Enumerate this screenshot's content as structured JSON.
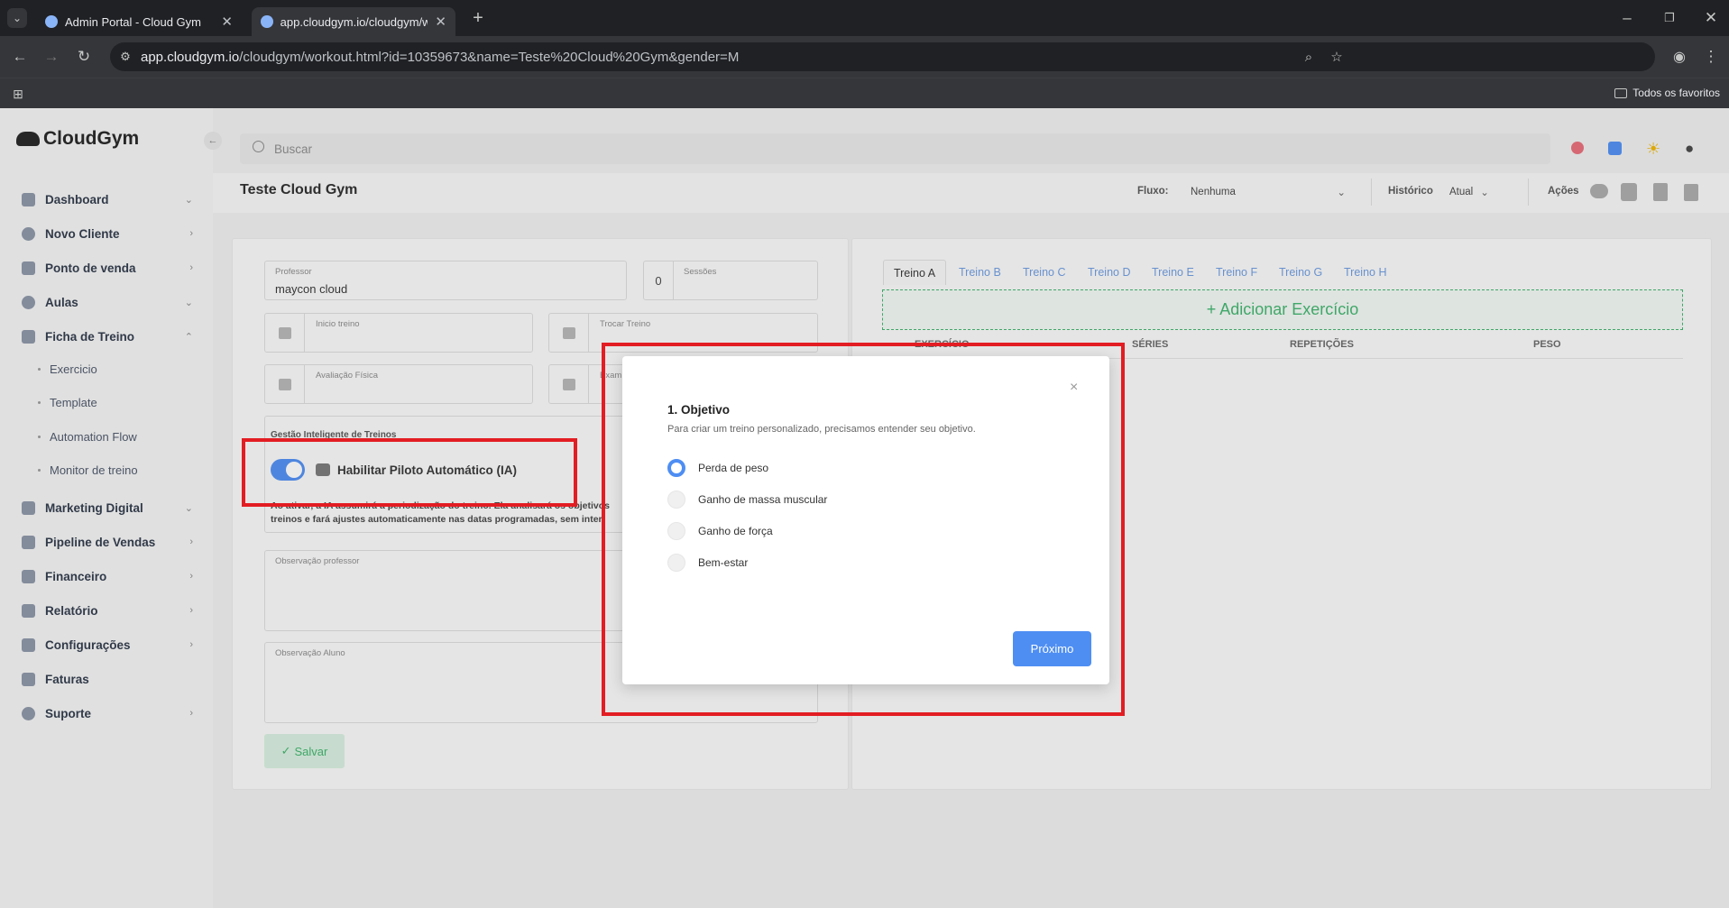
{
  "browser": {
    "tabs": [
      {
        "title": "Admin Portal - Cloud Gym"
      },
      {
        "title": "app.cloudgym.io/cloudgym/wo"
      }
    ],
    "url_host": "app.cloudgym.io",
    "url_path": "/cloudgym/workout.html?id=10359673&name=Teste%20Cloud%20Gym&gender=M",
    "bookmarks_label": "Todos os favoritos"
  },
  "sidebar": {
    "logo": "CloudGym",
    "items": [
      {
        "label": "Dashboard",
        "chev": "⌄"
      },
      {
        "label": "Novo Cliente",
        "chev": "›"
      },
      {
        "label": "Ponto de venda",
        "chev": "›"
      },
      {
        "label": "Aulas",
        "chev": "⌄"
      },
      {
        "label": "Ficha de Treino",
        "chev": "⌃"
      },
      {
        "label": "Marketing Digital",
        "chev": "⌄"
      },
      {
        "label": "Pipeline de Vendas",
        "chev": "›"
      },
      {
        "label": "Financeiro",
        "chev": "›"
      },
      {
        "label": "Relatório",
        "chev": "›"
      },
      {
        "label": "Configurações",
        "chev": "›"
      },
      {
        "label": "Faturas",
        "chev": ""
      },
      {
        "label": "Suporte",
        "chev": "›"
      }
    ],
    "subitems": [
      "Exercicio",
      "Template",
      "Automation Flow",
      "Monitor de treino"
    ]
  },
  "search": {
    "placeholder": "Buscar"
  },
  "header": {
    "title": "Teste Cloud Gym",
    "fluxo_label": "Fluxo:",
    "fluxo_value": "Nenhuma",
    "historico_label": "Histórico",
    "historico_value": "Atual",
    "acoes_label": "Ações"
  },
  "form": {
    "professor_label": "Professor",
    "professor_value": "maycon cloud",
    "sessions_count": "0",
    "sessions_label": "Sessões",
    "inicio_label": "Inicio treino",
    "trocar_label": "Trocar Treino",
    "avaliacao_label": "Avaliação Física",
    "exame_label": "Exam",
    "gestao_label": "Gestão Inteligente de Treinos",
    "autopilot_label": "Habilitar Piloto Automático (IA)",
    "autopilot_enabled": true,
    "autopilot_desc1": "Ao ativar, a IA assumirá a periodização do treino. Ela analisará os objetivos",
    "autopilot_desc2": "treinos e fará ajustes automaticamente nas datas programadas, sem inter",
    "obs_prof_label": "Observação professor",
    "obs_aluno_label": "Observação Aluno",
    "save_label": "Salvar"
  },
  "workout": {
    "tabs": [
      "Treino A",
      "Treino B",
      "Treino C",
      "Treino D",
      "Treino E",
      "Treino F",
      "Treino G",
      "Treino H"
    ],
    "add_label": "+ Adicionar Exercício",
    "columns": [
      "EXERCÍCIO",
      "SÉRIES",
      "REPETIÇÕES",
      "PESO"
    ]
  },
  "modal": {
    "title": "1. Objetivo",
    "subtitle": "Para criar um treino personalizado, precisamos entender seu objetivo.",
    "options": [
      "Perda de peso",
      "Ganho de massa muscular",
      "Ganho de força",
      "Bem-estar"
    ],
    "selected": "Perda de peso",
    "close_glyph": "×",
    "next_label": "Próximo"
  },
  "colors": {
    "accent": "#4e8ef3",
    "green": "#3db36b",
    "highlight": "#e21d23"
  }
}
